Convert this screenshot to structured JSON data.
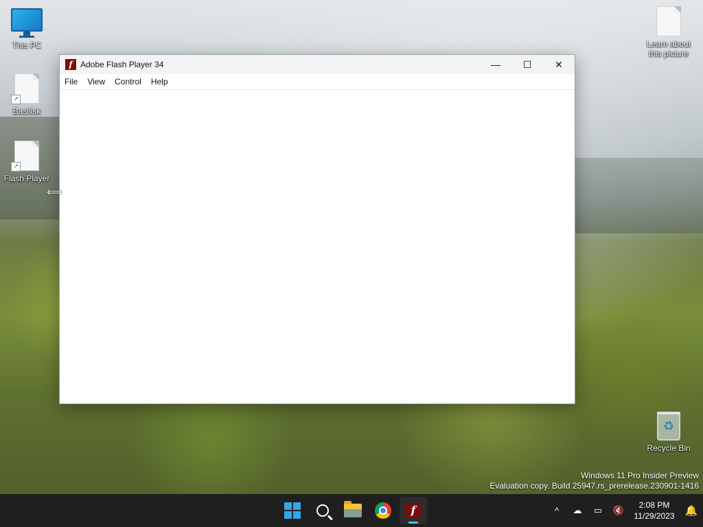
{
  "desktop": {
    "icons": [
      {
        "label": "This PC"
      },
      {
        "label": "Basilisk"
      },
      {
        "label": "Flash Player"
      },
      {
        "label": "Learn about this picture"
      },
      {
        "label": "Recycle Bin"
      }
    ],
    "watermark": {
      "line1": "Windows 11 Pro Insider Preview",
      "line2": "Evaluation copy. Build 25947.rs_prerelease.230901-1416"
    }
  },
  "window": {
    "title": "Adobe Flash Player 34",
    "app_icon_glyph": "f",
    "controls": {
      "minimize": "—",
      "maximize": "☐",
      "close": "✕"
    },
    "menu": [
      "File",
      "View",
      "Control",
      "Help"
    ]
  },
  "cursor": {
    "glyph": "⟺"
  },
  "taskbar": {
    "apps": [
      "start",
      "search",
      "file-explorer",
      "chrome",
      "flash-player"
    ],
    "active_app": "flash-player",
    "tray": {
      "chevron": "^",
      "time": "2:08 PM",
      "date": "11/29/2023"
    }
  },
  "colors": {
    "taskbar_bg": "#1f1f1f",
    "accent": "#4cc2ff",
    "flash_red": "#7a0d0d"
  }
}
